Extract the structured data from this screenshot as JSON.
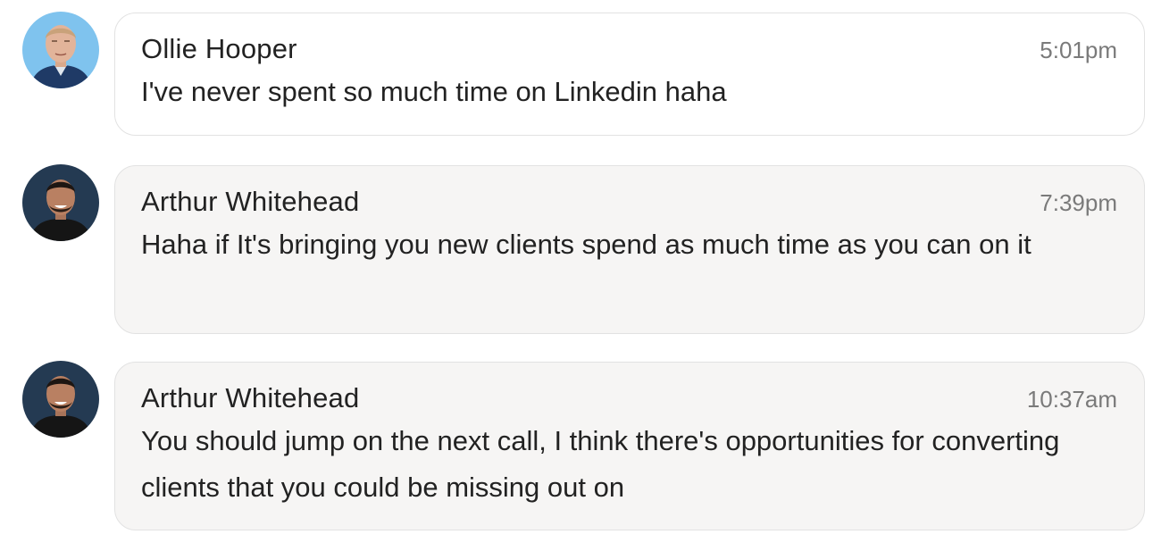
{
  "messages": [
    {
      "sender": "Ollie Hooper",
      "time": "5:01pm",
      "text": "I've never spent so much time on Linkedin haha",
      "avatar_icon": "person-avatar-icon",
      "bubble_color": "#ffffff"
    },
    {
      "sender": "Arthur Whitehead",
      "time": "7:39pm",
      "text": "Haha if It's bringing you new clients spend as much time as you can on it",
      "avatar_icon": "person-avatar-icon",
      "bubble_color": "#f6f5f4"
    },
    {
      "sender": "Arthur Whitehead",
      "time": "10:37am",
      "text": "You should jump on the next call, I think there's opportunities for converting clients that you could be missing out on",
      "avatar_icon": "person-avatar-icon",
      "bubble_color": "#f6f5f4"
    }
  ],
  "colors": {
    "text": "#222222",
    "timestamp": "#7a7a7a",
    "border": "#e2e2e2"
  }
}
